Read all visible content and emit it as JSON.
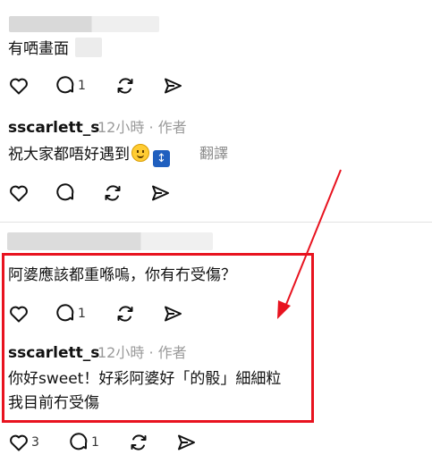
{
  "posts": [
    {
      "text": "有哂畫面",
      "counts": {
        "like": "",
        "comment": "1",
        "repost": "",
        "share": ""
      }
    },
    {
      "username": "sscarlett_s",
      "time": "12小時",
      "role": "作者",
      "text": "祝大家都唔好遇到",
      "emoji_names": [
        "smiling-face-icon",
        "up-down-arrow-icon"
      ],
      "translate_label": "翻譯",
      "counts": {
        "like": "",
        "comment": "",
        "repost": "",
        "share": ""
      }
    },
    {
      "text": "阿婆應該都重喺嗚，你有冇受傷？",
      "counts": {
        "like": "",
        "comment": "1",
        "repost": "",
        "share": ""
      }
    },
    {
      "username": "sscarlett_s",
      "time": "12小時",
      "role": "作者",
      "text_line1": "你好sweet！好彩阿婆好「的骰」細細粒",
      "text_line2": "我目前冇受傷",
      "counts": {
        "like": "3",
        "comment": "1",
        "repost": "",
        "share": ""
      }
    }
  ],
  "separator": "·",
  "colors": {
    "annotation_red": "#e8131f",
    "meta_gray": "#9a9a9a"
  }
}
